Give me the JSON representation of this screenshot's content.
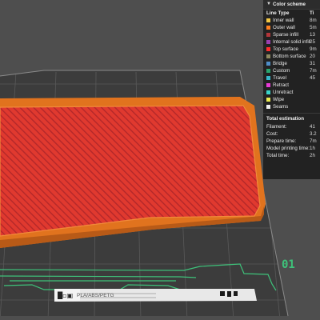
{
  "legend": {
    "title": "Color scheme",
    "col_line_type": "Line Type",
    "col_time": "Ti",
    "items": [
      {
        "label": "Inner wall",
        "color": "#f2c744",
        "value": "8m"
      },
      {
        "label": "Outer wall",
        "color": "#ff7f1f",
        "value": "5m"
      },
      {
        "label": "Sparse infill",
        "color": "#b3363a",
        "value": "13"
      },
      {
        "label": "Internal solid infill",
        "color": "#9a3fb0",
        "value": "25"
      },
      {
        "label": "Top surface",
        "color": "#ff2d2d",
        "value": "9m"
      },
      {
        "label": "Bottom surface",
        "color": "#8f8a60",
        "value": "20"
      },
      {
        "label": "Bridge",
        "color": "#4f8ec9",
        "value": "31"
      },
      {
        "label": "Custom",
        "color": "#2aa56e",
        "value": "7m"
      },
      {
        "label": "Travel",
        "color": "#36b7c9",
        "value": "45"
      },
      {
        "label": "Retract",
        "color": "#e93bd6",
        "value": ""
      },
      {
        "label": "Unretract",
        "color": "#3ad4c9",
        "value": ""
      },
      {
        "label": "Wipe",
        "color": "#ecec50",
        "value": ""
      },
      {
        "label": "Seams",
        "color": "#efefef",
        "value": ""
      }
    ],
    "estimation_title": "Total estimation",
    "estimation": [
      {
        "label": "Filament:",
        "value": "41"
      },
      {
        "label": "Cost:",
        "value": "3.2"
      },
      {
        "label": "Prepare time:",
        "value": "7m"
      },
      {
        "label": "Model printing time:",
        "value": "1h"
      },
      {
        "label": "Total time:",
        "value": "2h"
      }
    ]
  },
  "plate": {
    "label": "PLA/ABS/PETG",
    "number": "01",
    "icon_glyphs": "█▫▣"
  },
  "colors": {
    "bed": "#3c3c3c",
    "grid": "#5a5a5a",
    "accent_green": "#3ec27a",
    "model_top": "#e0392f",
    "model_outer": "#e1731e"
  }
}
